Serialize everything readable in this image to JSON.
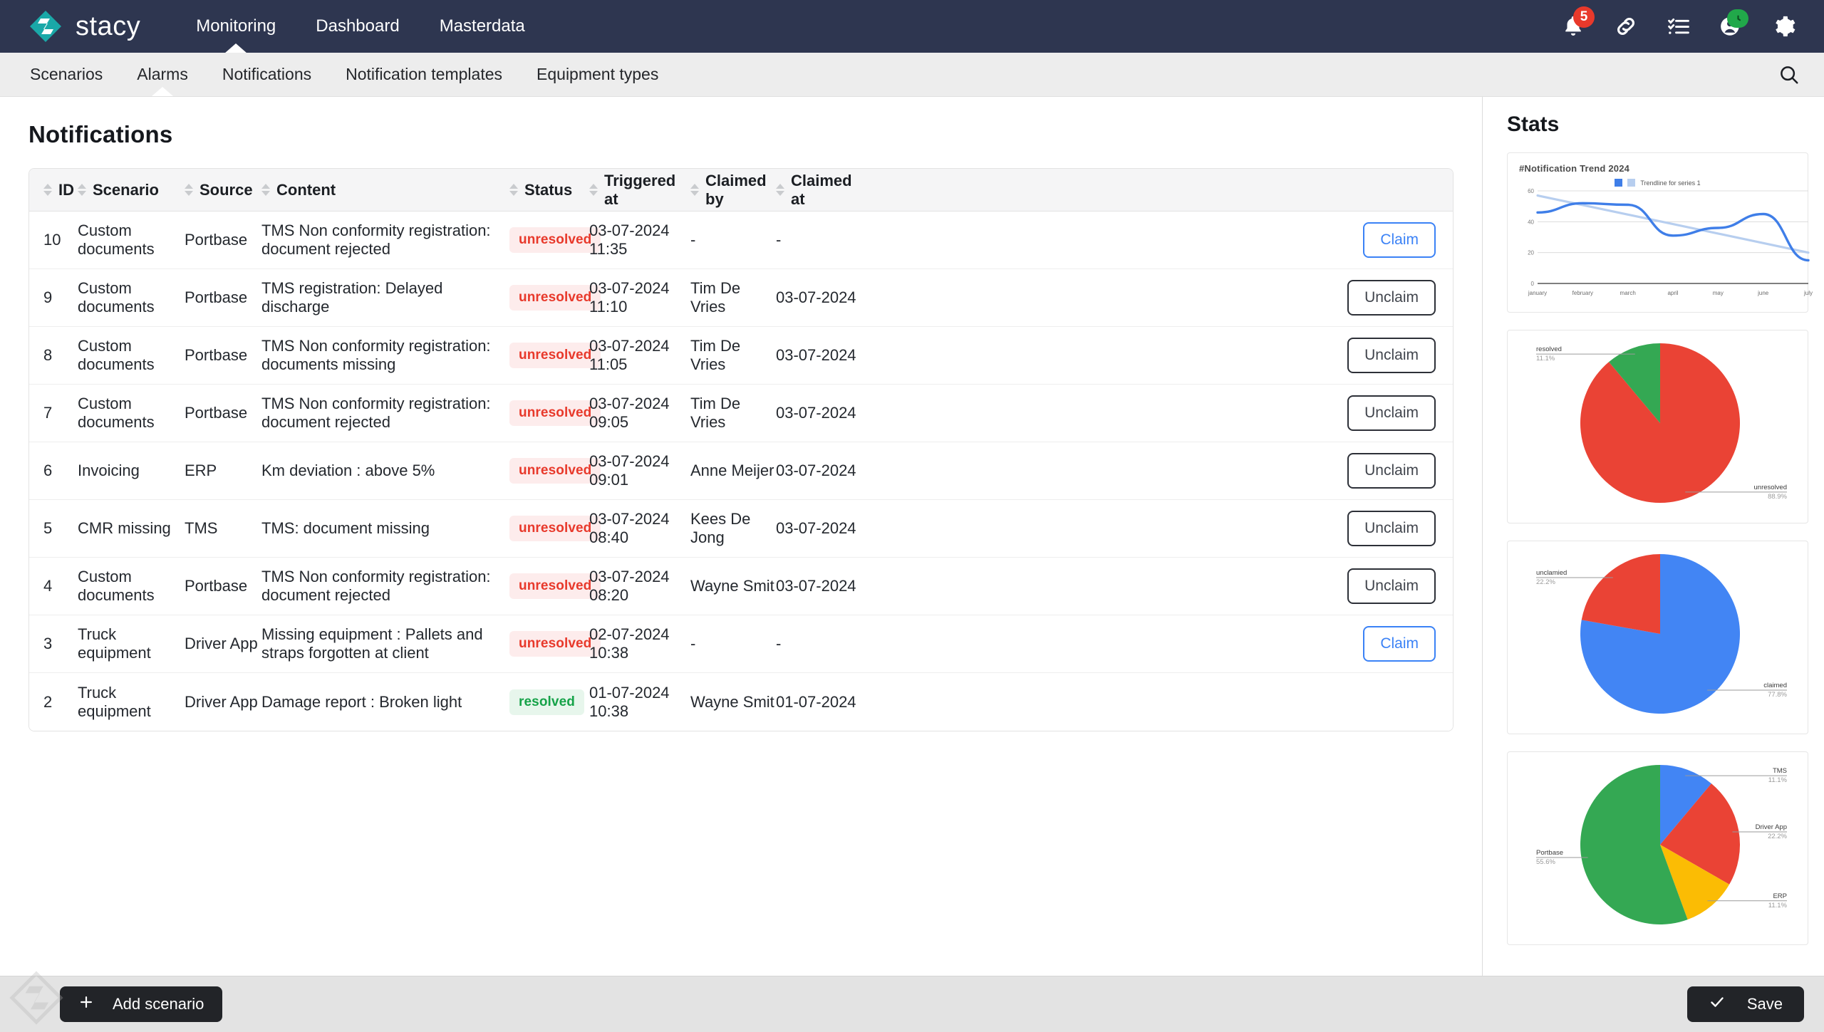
{
  "topbar": {
    "brand": "stacy",
    "nav": [
      {
        "label": "Monitoring",
        "active": true
      },
      {
        "label": "Dashboard",
        "active": false
      },
      {
        "label": "Masterdata",
        "active": false
      }
    ],
    "actions": [
      {
        "icon": "bell-icon",
        "badge": "5"
      },
      {
        "icon": "link-icon",
        "badge": ""
      },
      {
        "icon": "checklist-icon",
        "badge": ""
      },
      {
        "icon": "user-clock-icon",
        "badge": ""
      },
      {
        "icon": "gear-icon",
        "badge": ""
      }
    ]
  },
  "subnav": {
    "items": [
      {
        "label": "Scenarios",
        "active": false
      },
      {
        "label": "Alarms",
        "active": true
      },
      {
        "label": "Notifications",
        "active": false
      },
      {
        "label": "Notification templates",
        "active": false
      },
      {
        "label": "Equipment types",
        "active": false
      }
    ],
    "search_icon": "search-icon"
  },
  "main": {
    "page_title": "Notifications",
    "columns": [
      "ID",
      "Scenario",
      "Source",
      "Content",
      "Status",
      "Triggered at",
      "Claimed by",
      "Claimed at"
    ],
    "rows": [
      {
        "id": "10",
        "scenario": "Custom documents",
        "source": "Portbase",
        "content": "TMS Non conformity registration: document rejected",
        "status": "unresolved",
        "triggered_at": "03-07-2024 11:35",
        "claimed_by": "-",
        "claimed_at": "-",
        "action": "Claim"
      },
      {
        "id": "9",
        "scenario": "Custom documents",
        "source": "Portbase",
        "content": "TMS registration: Delayed discharge",
        "status": "unresolved",
        "triggered_at": "03-07-2024 11:10",
        "claimed_by": "Tim De Vries",
        "claimed_at": "03-07-2024",
        "action": "Unclaim"
      },
      {
        "id": "8",
        "scenario": "Custom documents",
        "source": "Portbase",
        "content": "TMS Non conformity registration: documents missing",
        "status": "unresolved",
        "triggered_at": "03-07-2024 11:05",
        "claimed_by": "Tim De Vries",
        "claimed_at": "03-07-2024",
        "action": "Unclaim"
      },
      {
        "id": "7",
        "scenario": "Custom documents",
        "source": "Portbase",
        "content": "TMS Non conformity registration: document rejected",
        "status": "unresolved",
        "triggered_at": "03-07-2024 09:05",
        "claimed_by": "Tim De Vries",
        "claimed_at": "03-07-2024",
        "action": "Unclaim"
      },
      {
        "id": "6",
        "scenario": "Invoicing",
        "source": "ERP",
        "content": "Km deviation : above 5%",
        "status": "unresolved",
        "triggered_at": "03-07-2024 09:01",
        "claimed_by": "Anne Meijer",
        "claimed_at": "03-07-2024",
        "action": "Unclaim"
      },
      {
        "id": "5",
        "scenario": "CMR missing",
        "source": "TMS",
        "content": "TMS: document missing",
        "status": "unresolved",
        "triggered_at": "03-07-2024 08:40",
        "claimed_by": "Kees De Jong",
        "claimed_at": "03-07-2024",
        "action": "Unclaim"
      },
      {
        "id": "4",
        "scenario": "Custom documents",
        "source": "Portbase",
        "content": "TMS Non conformity registration: document rejected",
        "status": "unresolved",
        "triggered_at": "03-07-2024 08:20",
        "claimed_by": "Wayne Smit",
        "claimed_at": "03-07-2024",
        "action": "Unclaim"
      },
      {
        "id": "3",
        "scenario": "Truck equipment",
        "source": "Driver App",
        "content": "Missing equipment : Pallets and straps forgotten at client",
        "status": "unresolved",
        "triggered_at": "02-07-2024 10:38",
        "claimed_by": "-",
        "claimed_at": "-",
        "action": "Claim"
      },
      {
        "id": "2",
        "scenario": "Truck equipment",
        "source": "Driver App",
        "content": "Damage report : Broken light",
        "status": "resolved",
        "triggered_at": "01-07-2024 10:38",
        "claimed_by": "Wayne Smit",
        "claimed_at": "01-07-2024",
        "action": ""
      }
    ]
  },
  "stats": {
    "title": "Stats"
  },
  "chart_data": [
    {
      "type": "line",
      "title": "#Notification Trend 2024",
      "legend": [
        "",
        "Trendline for series 1"
      ],
      "legend_position": "top-center",
      "x": [
        "january",
        "february",
        "march",
        "april",
        "may",
        "june",
        "july"
      ],
      "xlabel": "",
      "ylabel": "",
      "ylim": [
        0,
        60
      ],
      "yticks": [
        0,
        20,
        40,
        60
      ],
      "grid": true,
      "series": [
        {
          "name": "series 1",
          "values": [
            46,
            52,
            51,
            31,
            36,
            45,
            15
          ],
          "color": "#3f7ee8"
        },
        {
          "name": "Trendline for series 1",
          "values": [
            57,
            51,
            45,
            39,
            33,
            26,
            20
          ],
          "color": "#b7ceef"
        }
      ]
    },
    {
      "type": "pie",
      "title": "",
      "labels": [
        "unresolved",
        "resolved"
      ],
      "values": [
        88.9,
        11.1
      ],
      "value_labels": [
        "88.9%",
        "11.1%"
      ],
      "colors": [
        "#ea4335",
        "#34a853"
      ]
    },
    {
      "type": "pie",
      "title": "",
      "labels": [
        "claimed",
        "unclamied"
      ],
      "values": [
        77.8,
        22.2
      ],
      "value_labels": [
        "77.8%",
        "22.2%"
      ],
      "colors": [
        "#4285f4",
        "#ea4335"
      ]
    },
    {
      "type": "pie",
      "title": "",
      "labels": [
        "TMS",
        "Driver App",
        "ERP",
        "Portbase"
      ],
      "values": [
        11.1,
        22.2,
        11.1,
        55.6
      ],
      "value_labels": [
        "11.1%",
        "22.2%",
        "11.1%",
        "55.6%"
      ],
      "colors": [
        "#4285f4",
        "#ea4335",
        "#fbbc04",
        "#34a853"
      ]
    }
  ],
  "footer": {
    "add_scenario": "Add scenario",
    "add_icon": "plus-icon",
    "save": "Save",
    "save_icon": "check-icon"
  }
}
